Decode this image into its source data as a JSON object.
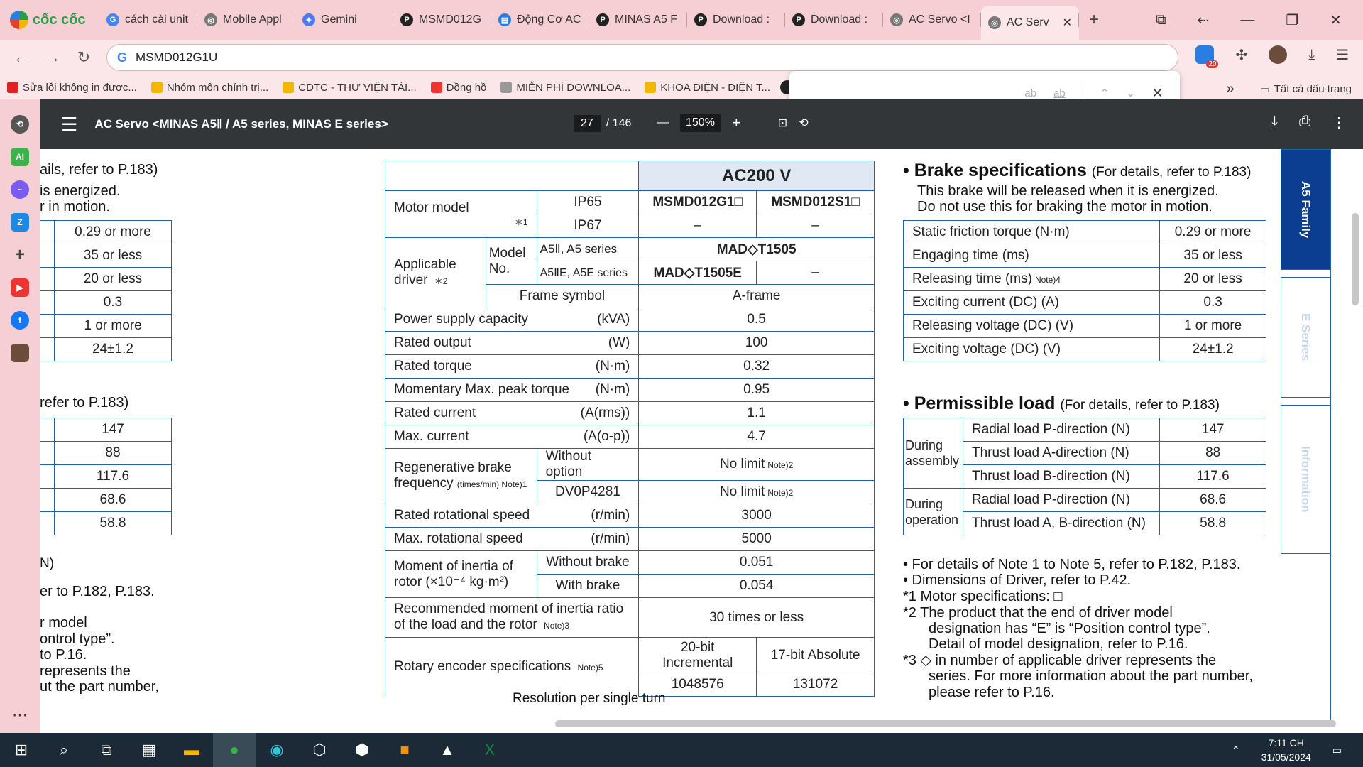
{
  "browser": {
    "brand": "cốc cốc",
    "tabs": [
      {
        "title": "cách cài unit",
        "icon": "google-icon",
        "color": "#4285f4",
        "glyph": "G"
      },
      {
        "title": "Mobile Appl",
        "icon": "globe-icon",
        "color": "#777",
        "glyph": "◎"
      },
      {
        "title": "Gemini",
        "icon": "gemini-icon",
        "color": "#4b7bec",
        "glyph": "✦"
      },
      {
        "title": "MSMD012G",
        "icon": "pdf-p-icon",
        "color": "#222",
        "glyph": "P"
      },
      {
        "title": "Động Cơ AC",
        "icon": "doc-icon",
        "color": "#2a7de1",
        "glyph": "▤"
      },
      {
        "title": "MINAS A5 F",
        "icon": "pdf-p-icon",
        "color": "#222",
        "glyph": "P"
      },
      {
        "title": "Download :",
        "icon": "pdf-p-icon",
        "color": "#222",
        "glyph": "P"
      },
      {
        "title": "Download :",
        "icon": "pdf-p-icon",
        "color": "#222",
        "glyph": "P"
      },
      {
        "title": "AC Servo <I",
        "icon": "globe-icon",
        "color": "#777",
        "glyph": "◎"
      },
      {
        "title": "AC Serv",
        "icon": "globe-icon",
        "color": "#777",
        "glyph": "◎",
        "active": true
      }
    ],
    "new_tab": "+",
    "address": "MSMD012G1U",
    "extension_badge": "20",
    "bookmarks": [
      {
        "label": "Sửa lỗi không in được...",
        "color": "#d22"
      },
      {
        "label": "Nhóm môn chính trị...",
        "color": "#f2b705"
      },
      {
        "label": "CDTC - THƯ VIỆN TÀI...",
        "color": "#f2b705"
      },
      {
        "label": "Đồng hồ",
        "color": "#e33"
      },
      {
        "label": "MIỄN PHÍ DOWNLOA...",
        "color": "#999"
      },
      {
        "label": "KHOA ĐIỆN - ĐIỆN T...",
        "color": "#f2b705"
      }
    ],
    "more_bookmarks": "»",
    "all_bookmarks": "Tất cả dấu trang",
    "find": {
      "opt1": "ab",
      "opt2": "ab"
    }
  },
  "pdf": {
    "title": "AC Servo <MINAS A5Ⅱ / A5 series, MINAS E series>",
    "page": "27",
    "total": "/ 146",
    "zoom": "150%"
  },
  "main_table": {
    "header": "AC200 V",
    "motor_model": "Motor model",
    "note1": "＊1",
    "ip65": "IP65",
    "ip67": "IP67",
    "m1": "MSMD012G1□",
    "m2": "MSMD012S1□",
    "dash": "–",
    "applicable_driver": "Applicable driver",
    "note2": "＊2",
    "model_no": "Model No.",
    "a5": "A5Ⅱ, A5 series",
    "a5e": "A5ⅡE, A5E series",
    "driver1": "MAD◇T1505",
    "driver2": "MAD◇T1505E",
    "frame_symbol": "Frame symbol",
    "frame": "A-frame",
    "rows": [
      {
        "label": "Power supply capacity",
        "unit": "(kVA)",
        "value": "0.5"
      },
      {
        "label": "Rated output",
        "unit": "(W)",
        "value": "100"
      },
      {
        "label": "Rated torque",
        "unit": "(N·m)",
        "value": "0.32"
      },
      {
        "label": "Momentary Max. peak torque",
        "unit": "(N·m)",
        "value": "0.95"
      },
      {
        "label": "Rated current",
        "unit": "(A(rms))",
        "value": "1.1"
      },
      {
        "label": "Max. current",
        "unit": "(A(o-p))",
        "value": "4.7"
      }
    ],
    "regen_label": "Regenerative brake frequency",
    "regen_unit": "(times/min) Note)1",
    "regen_opt1": "Without option",
    "regen_opt2": "DV0P4281",
    "no_limit": "No limit",
    "note2b": "Note)2",
    "rows2": [
      {
        "label": "Rated rotational speed",
        "unit": "(r/min)",
        "value": "3000"
      },
      {
        "label": "Max. rotational speed",
        "unit": "(r/min)",
        "value": "5000"
      }
    ],
    "inertia_label": "Moment of inertia of rotor (×10⁻⁴ kg·m²)",
    "inertia_wo": "Without brake",
    "inertia_wo_val": "0.051",
    "inertia_w": "With brake",
    "inertia_w_val": "0.054",
    "ratio_label": "Recommended moment of inertia ratio of the load and the rotor",
    "note3": "Note)3",
    "ratio_val": "30 times or less",
    "encoder_label": "Rotary encoder specifications",
    "note5": "Note)5",
    "enc1": "20-bit Incremental",
    "enc2": "17-bit Absolute",
    "resolution_label": "Resolution per single turn",
    "res1": "1048576",
    "res2": "131072"
  },
  "brake": {
    "title": "• Brake specifications",
    "ref": "(For details, refer to P.183)",
    "paren1": "This brake will be released when it is energized.",
    "paren2": "Do not use this for braking the motor in motion.",
    "rows": [
      {
        "label": "Static friction torque (N·m)",
        "value": "0.29 or more"
      },
      {
        "label": "Engaging time (ms)",
        "value": "35 or less"
      },
      {
        "label": "Releasing time (ms)",
        "note": "Note)4",
        "value": "20 or less"
      },
      {
        "label": "Exciting current (DC) (A)",
        "value": "0.3"
      },
      {
        "label": "Releasing voltage (DC) (V)",
        "value": "1 or more"
      },
      {
        "label": "Exciting voltage (DC) (V)",
        "value": "24±1.2"
      }
    ]
  },
  "load": {
    "title": "• Permissible load",
    "ref": "(For details, refer to P.183)",
    "assembly": "During assembly",
    "operation": "During operation",
    "rows": [
      {
        "label": "Radial load P-direction (N)",
        "value": "147"
      },
      {
        "label": "Thrust load A-direction (N)",
        "value": "88"
      },
      {
        "label": "Thrust load B-direction (N)",
        "value": "117.6"
      },
      {
        "label": "Radial load P-direction (N)",
        "value": "68.6"
      },
      {
        "label": "Thrust load A, B-direction (N)",
        "value": "58.8"
      }
    ]
  },
  "notes": [
    "• For details of Note 1 to Note 5, refer to P.182, P.183.",
    "• Dimensions of Driver, refer to P.42.",
    "*1 Motor specifications: □",
    "*2 The product that the end of driver model",
    "designation has “E” is “Position control type”.",
    "Detail of model designation, refer to P.16.",
    "*3 ◇ in number of applicable driver represents the",
    "series. For more information about the part number,",
    "please refer to P.16."
  ],
  "left_partial": {
    "l1": "ails, refer to P.183)",
    "l2": "is energized.",
    "l3": "r in motion.",
    "l4": "refer to P.183)",
    "l5": "er to P.182, P.183.",
    "l6": "r model",
    "l7": "ontrol type”.",
    "l8": "to P.16.",
    "l9": "represents the",
    "l10": "ut the part number,",
    "brake_vals": [
      "0.29 or more",
      "35 or less",
      "20 or less",
      "0.3",
      "1 or more",
      "24±1.2"
    ],
    "load_vals": [
      "147",
      "88",
      "117.6",
      "68.6",
      "58.8"
    ],
    "n_frag": "N)"
  },
  "side_tabs": [
    "A5 Family",
    "E Series",
    "Information"
  ],
  "taskbar": {
    "time": "7:11 CH",
    "date": "31/05/2024"
  }
}
